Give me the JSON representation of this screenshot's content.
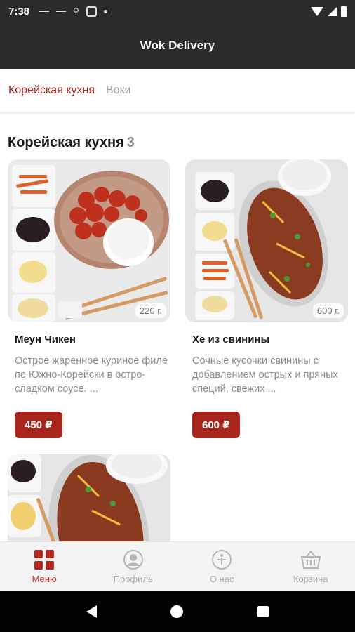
{
  "status_bar": {
    "time": "7:38"
  },
  "app_bar": {
    "title": "Wok Delivery"
  },
  "tabs": [
    {
      "label": "Корейская кухня",
      "active": true
    },
    {
      "label": "Воки",
      "active": false
    }
  ],
  "section": {
    "title": "Корейская кухня",
    "count": "3"
  },
  "products": [
    {
      "name": "Меун Чикен",
      "weight": "220 г.",
      "description": "Острое жаренное куриное филе по Южно-Корейски в остро-сладком соусе. ...",
      "price": "450 ₽"
    },
    {
      "name": "Хе из свинины",
      "weight": "600 г.",
      "description": "Сочные кусочки свинины с добавлением острых и пряных специй, свежих ...",
      "price": "600 ₽"
    }
  ],
  "bottom_nav": [
    {
      "label": "Меню",
      "icon": "menu-grid-icon",
      "active": true
    },
    {
      "label": "Профиль",
      "icon": "profile-icon",
      "active": false
    },
    {
      "label": "О нас",
      "icon": "about-icon",
      "active": false
    },
    {
      "label": "Корзина",
      "icon": "basket-icon",
      "active": false
    }
  ],
  "colors": {
    "accent": "#b3261e",
    "price_button": "#a8251e",
    "app_bar": "#2d2b29"
  }
}
